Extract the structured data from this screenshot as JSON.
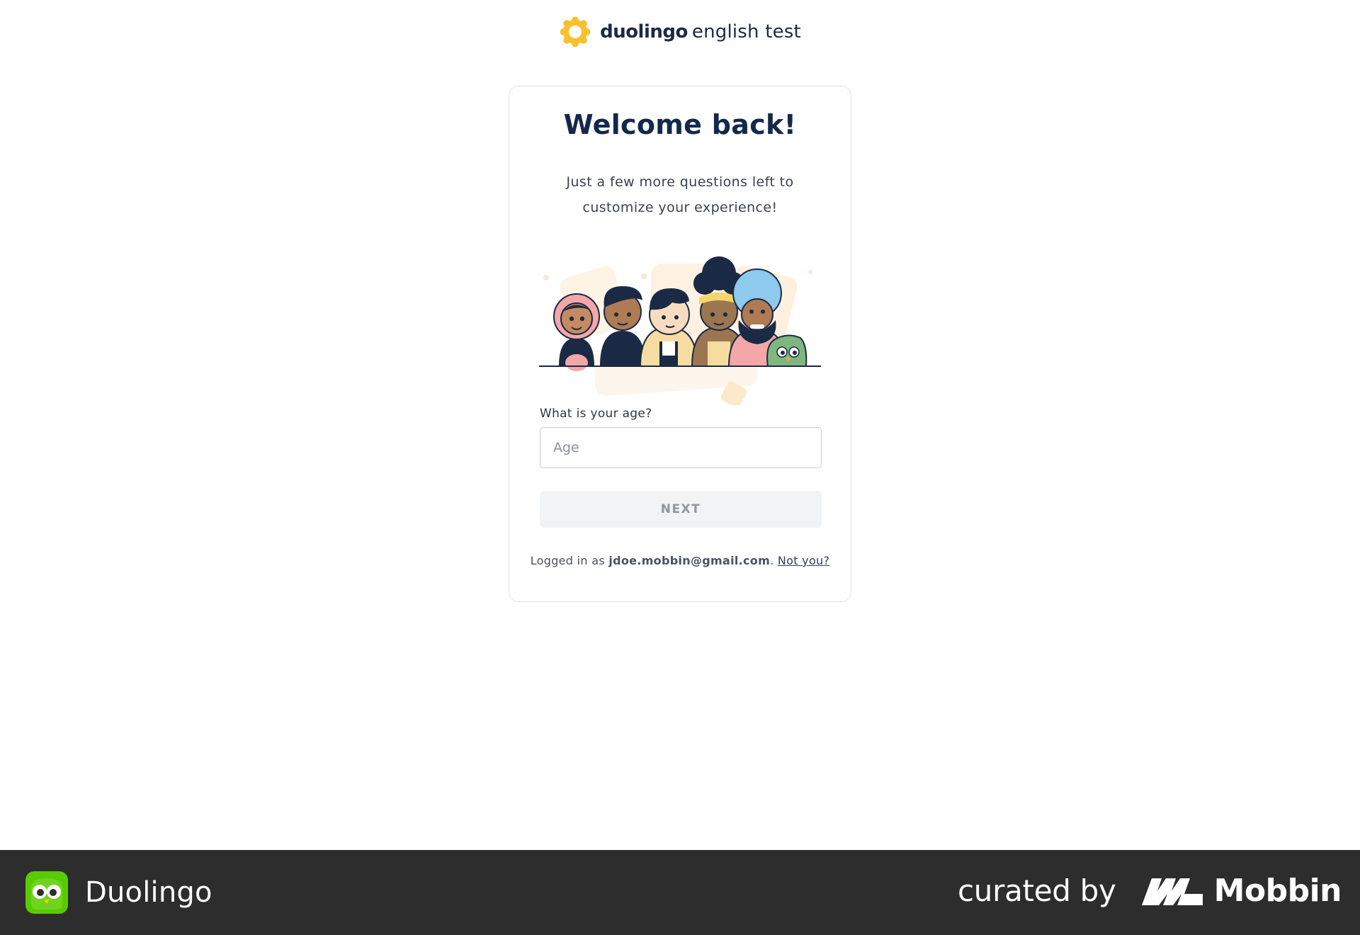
{
  "header": {
    "brand_bold": "duolingo",
    "brand_rest": "english test"
  },
  "card": {
    "title": "Welcome back!",
    "subtitle": "Just a few more questions left to customize your experience!",
    "age_field": {
      "label": "What is your age?",
      "placeholder": "Age",
      "value": ""
    },
    "next_button": "NEXT",
    "login": {
      "prefix": "Logged in as",
      "email": "jdoe.mobbin@gmail.com",
      "suffix": ".",
      "not_you": "Not you?"
    }
  },
  "footer": {
    "app_name": "Duolingo",
    "curated_by": "curated by",
    "curator": "Mobbin"
  },
  "colors": {
    "brand_yellow": "#f6c12d",
    "title_navy": "#13294b",
    "button_disabled_bg": "#f1f3f5",
    "button_disabled_text": "#8e96a1",
    "footer_bg": "#2d2d2e",
    "duolingo_green": "#58cc02"
  },
  "icons": {
    "brand": "duolingo-english-test-logo-icon",
    "app": "duolingo-owl-icon",
    "curator": "mobbin-logo-icon"
  }
}
